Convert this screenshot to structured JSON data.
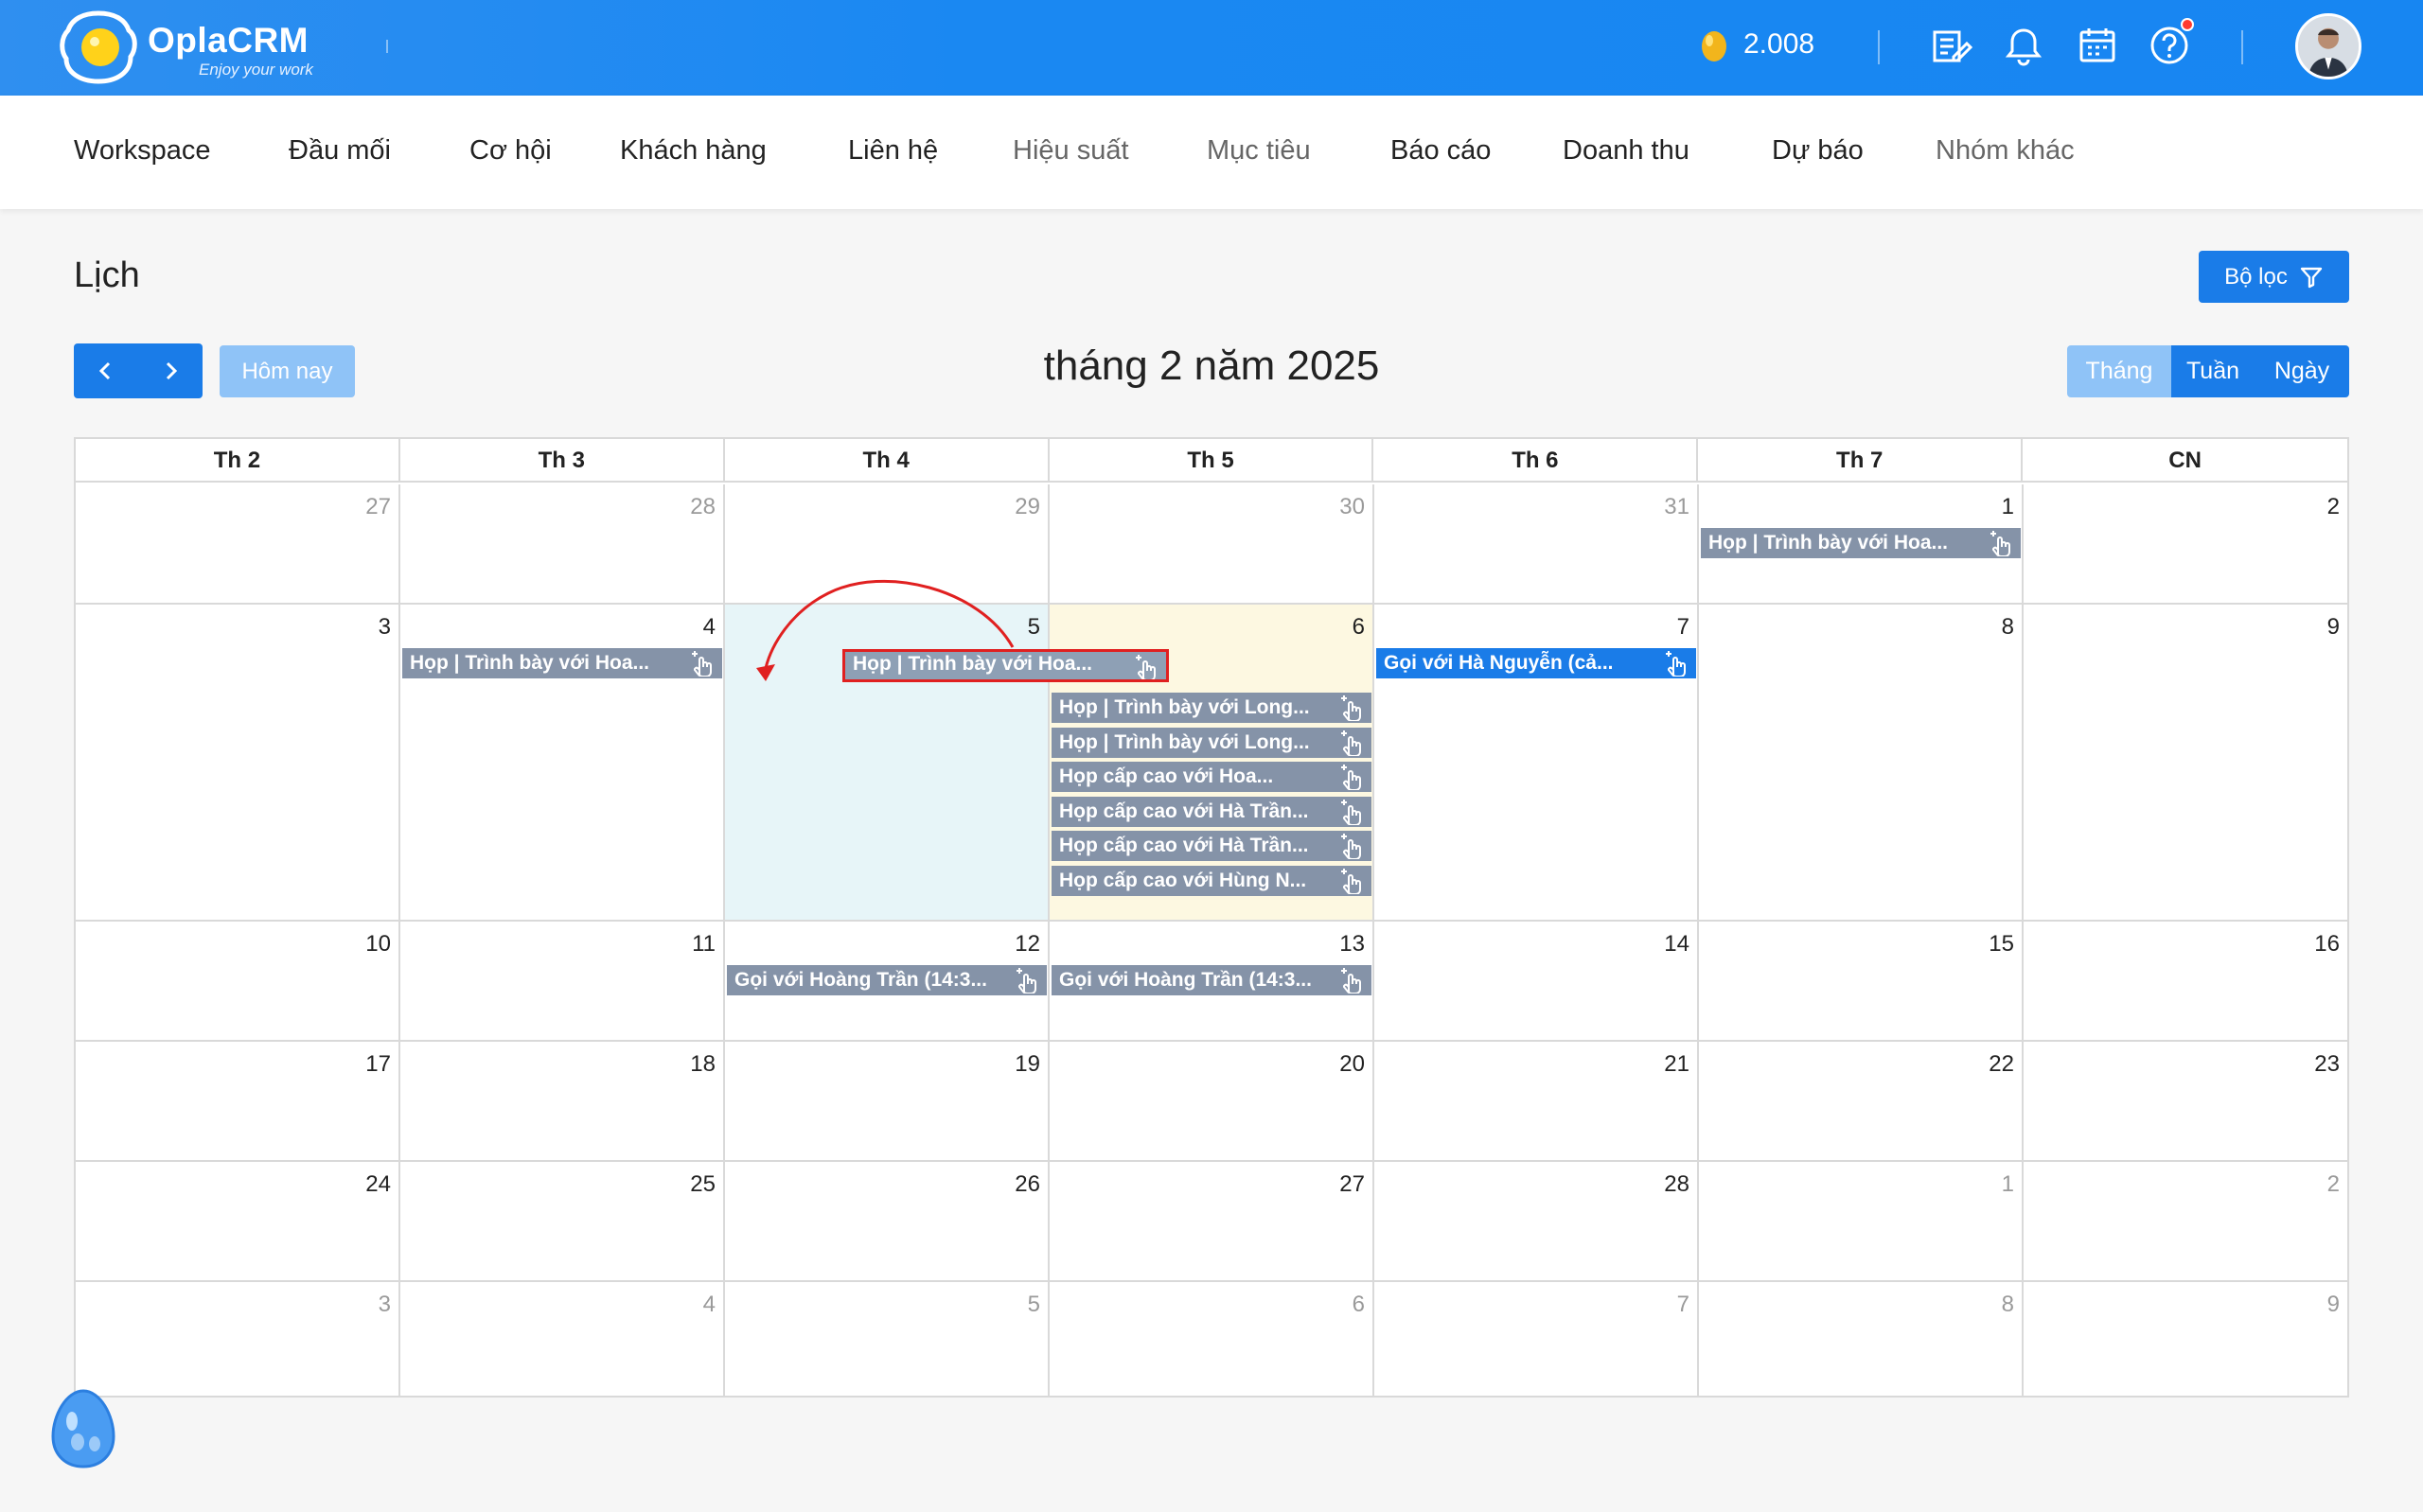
{
  "header": {
    "brand": "OplaCRM",
    "slogan": "Enjoy your work",
    "coins": "2.008",
    "icons": [
      "report-icon",
      "bell-icon",
      "calendar-icon",
      "help-icon"
    ]
  },
  "nav": {
    "items": [
      "Workspace",
      "Đầu mối",
      "Cơ hội",
      "Khách hàng",
      "Liên hệ",
      "Hiệu suất",
      "Mục tiêu",
      "Báo cáo",
      "Doanh thu",
      "Dự báo",
      "Nhóm khác"
    ]
  },
  "page": {
    "title": "Lịch",
    "filter_label": "Bộ lọc",
    "today_label": "Hôm nay",
    "month_title": "tháng 2 năm 2025",
    "views": [
      "Tháng",
      "Tuần",
      "Ngày"
    ],
    "active_view": "Tháng"
  },
  "calendar": {
    "weekdays": [
      "Th 2",
      "Th 3",
      "Th 4",
      "Th 5",
      "Th 6",
      "Th 7",
      "CN"
    ],
    "weeks": [
      [
        "27",
        "28",
        "29",
        "30",
        "31",
        "1",
        "2"
      ],
      [
        "3",
        "4",
        "5",
        "6",
        "7",
        "8",
        "9"
      ],
      [
        "10",
        "11",
        "12",
        "13",
        "14",
        "15",
        "16"
      ],
      [
        "17",
        "18",
        "19",
        "20",
        "21",
        "22",
        "23"
      ],
      [
        "24",
        "25",
        "26",
        "27",
        "28",
        "1",
        "2"
      ],
      [
        "3",
        "4",
        "5",
        "6",
        "7",
        "8",
        "9"
      ]
    ],
    "events": {
      "sat_1": "Họp | Trình bày với Hoa...",
      "tue_4": "Họp | Trình bày với Hoa...",
      "dragging": "Họp | Trình bày với Hoa...",
      "fri_7": "Gọi với Hà Nguyễn (cả...",
      "thu_6": [
        "Họp | Trình bày với Long...",
        "Họp | Trình bày với Long...",
        "Họp cấp cao với Hoa...",
        "Họp cấp cao với Hà Trần...",
        "Họp cấp cao với Hà Trần...",
        "Họp cấp cao với Hùng N..."
      ],
      "wed_12": "Gọi với Hoàng Trần (14:3...",
      "thu_13": "Gọi với Hoàng Trần (14:3..."
    }
  },
  "colors": {
    "header_blue": "#1786f2",
    "button_blue": "#1a7ce8",
    "event_gray": "#8593a8",
    "drag_outline": "#e02020",
    "today_yellow": "#fdf8e1",
    "drop_target": "#e7f5f8"
  }
}
